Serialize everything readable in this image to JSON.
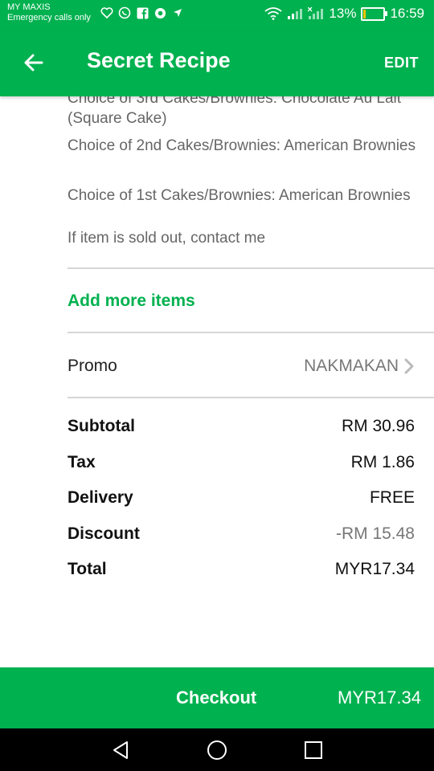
{
  "status_bar": {
    "carrier": "MY MAXIS",
    "carrier_sub": "Emergency calls only",
    "battery_percent": "13%",
    "battery_level": 0.13,
    "time": "16:59"
  },
  "app_bar": {
    "title": "Secret Recipe",
    "edit_label": "EDIT"
  },
  "item_options": [
    "Choice of 3rd Cakes/Brownies: Chocolate Au Lait (Square Cake)",
    "Choice of 2nd Cakes/Brownies: American Brownies",
    "Choice of 1st Cakes/Brownies: American Brownies",
    "If item is sold out, contact me"
  ],
  "add_more_label": "Add more items",
  "promo": {
    "label": "Promo",
    "code": "NAKMAKAN"
  },
  "summary": {
    "subtotal_label": "Subtotal",
    "subtotal_value": "RM 30.96",
    "tax_label": "Tax",
    "tax_value": "RM 1.86",
    "delivery_label": "Delivery",
    "delivery_value": "FREE",
    "discount_label": "Discount",
    "discount_value": "-RM 15.48",
    "total_label": "Total",
    "total_value": "MYR17.34"
  },
  "checkout": {
    "label": "Checkout",
    "amount": "MYR17.34"
  },
  "colors": {
    "brand_green": "#00b14f"
  }
}
